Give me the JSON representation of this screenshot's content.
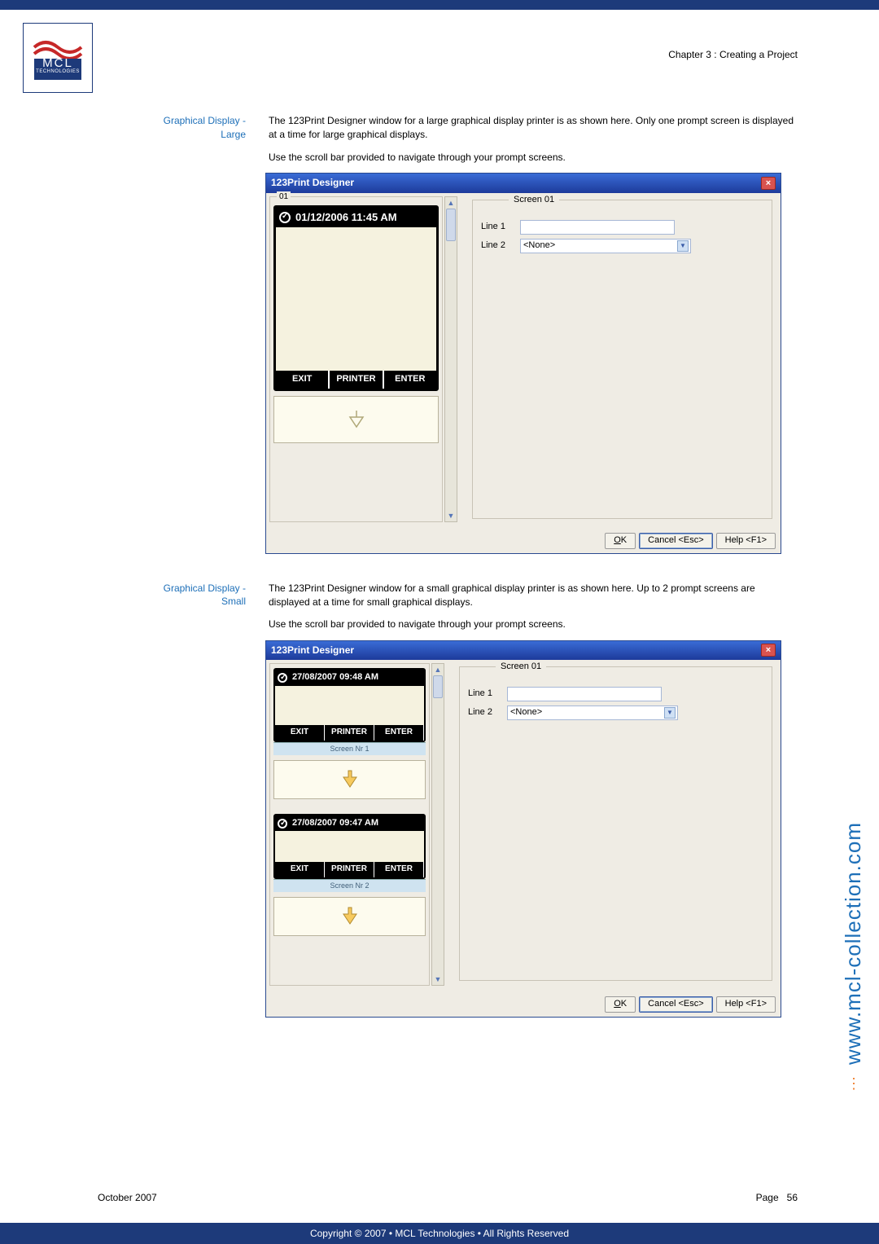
{
  "chapter": "Chapter 3 : Creating a Project",
  "logo_top": "MCL",
  "logo_bottom": "TECHNOLOGIES",
  "section1": {
    "label_line1": "Graphical Display -",
    "label_line2": "Large",
    "p1": "The 123Print Designer window for a large graphical display printer is as shown here. Only one prompt screen is displayed at a time for large graphical displays.",
    "p2": "Use the scroll bar provided to navigate through your prompt screens."
  },
  "section2": {
    "label_line1": "Graphical Display -",
    "label_line2": "Small",
    "p1": "The 123Print Designer window for a small graphical display printer is as shown here. Up to 2 prompt screens are displayed at a time for small graphical displays.",
    "p2": "Use the scroll bar provided to navigate through your prompt screens."
  },
  "win": {
    "title": "123Print Designer",
    "close": "×",
    "group01": "01",
    "screen_legend": "Screen 01",
    "line1_label": "Line 1",
    "line2_label": "Line 2",
    "line2_value": "<None>",
    "ok": "OK",
    "cancel": "Cancel <Esc>",
    "help": "Help <F1>"
  },
  "device_large": {
    "timestamp": "01/12/2006 11:45 AM",
    "exit": "EXIT",
    "printer": "PRINTER",
    "enter": "ENTER"
  },
  "device_small": {
    "ts1": "27/08/2007 09:48 AM",
    "ts2": "27/08/2007 09:47 AM",
    "cap1": "Screen Nr 1",
    "cap2": "Screen Nr 2",
    "exit": "EXIT",
    "printer": "PRINTER",
    "enter": "ENTER"
  },
  "footer": {
    "date": "October 2007",
    "page_label": "Page",
    "page_num": "56",
    "copyright": "Copyright © 2007 • MCL Technologies • All Rights Reserved"
  },
  "side_url": "www.mcl-collection.com"
}
